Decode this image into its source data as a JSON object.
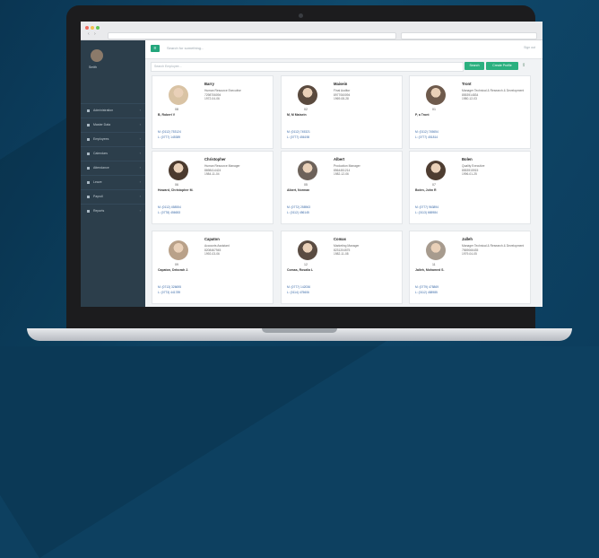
{
  "app": {
    "quick_search_placeholder": "Search for something...",
    "signout_label": "Sign out",
    "user_name": "Smith"
  },
  "sidebar": {
    "items": [
      {
        "label": "Administration"
      },
      {
        "label": "Master Data"
      },
      {
        "label": "Employees"
      },
      {
        "label": "Calendars"
      },
      {
        "label": "Attendance"
      },
      {
        "label": "Leave"
      },
      {
        "label": "Payroll"
      },
      {
        "label": "Reports"
      }
    ]
  },
  "search": {
    "placeholder": "Search Employee...",
    "search_button": "Search",
    "create_button": "Create Profile"
  },
  "employees": [
    {
      "first": "Barry",
      "title": "Human Resource Executive",
      "id": "7298706094",
      "dob": "1972-04-06",
      "code": "08",
      "name": "B, Robert V",
      "m": "M: (0112) 753124",
      "l": "L: (0777) 145389"
    },
    {
      "first": "Maisein",
      "title": "Final Auditor",
      "id": "8977060094",
      "dob": "1969-08-28",
      "code": "02",
      "name": "M, M Maisein",
      "m": "M: (0112) 745321",
      "l": "L: (0777) 456198"
    },
    {
      "first": "Tront",
      "title": "Manager Technical & Research & Development",
      "id": "8553914834",
      "dob": "1980-12-03",
      "code": "01",
      "name": "P, a Tront",
      "m": "M: (0112) 745654",
      "l": "L: (0777) 451814"
    },
    {
      "first": "Christopher",
      "title": "Human Resource Manager",
      "id": "8698414424",
      "dob": "1984-11-04",
      "code": "06",
      "name": "Howard, Christopher M.",
      "m": "M: (0112) 458554",
      "l": "L: (0778) 456653"
    },
    {
      "first": "Albert",
      "title": "Production Manager",
      "id": "8564451214",
      "dob": "1982-12-06",
      "code": "05",
      "name": "Albert, Norman",
      "m": "M: (0772) 258963",
      "l": "L: (0112) 456145"
    },
    {
      "first": "Bolen",
      "title": "Quality Executive",
      "id": "8553915915",
      "dob": "1996-01-25",
      "code": "07",
      "name": "Bolen, John R",
      "m": "M: (0777) 963894",
      "l": "L: (0113) 665984"
    },
    {
      "first": "Capaton",
      "title": "Accounts Assistant",
      "id": "8208467945",
      "dob": "1992-03-06",
      "code": "09",
      "name": "Capaton, Deborah J.",
      "m": "M: (0713) 326695",
      "l": "L: (0773) 441789"
    },
    {
      "first": "Comas",
      "title": "Marketing Manager",
      "id": "8231204575",
      "dob": "1982-11-08",
      "code": "12",
      "name": "Comas, Rosalia L",
      "m": "M: (0777) 142036",
      "l": "L: (0114) 475606"
    },
    {
      "first": "Jalleh",
      "title": "Manager Technical & Research & Development",
      "id": "7569066435",
      "dob": "1979-04-05",
      "code": "11",
      "name": "Jalleh, Mohamed S.",
      "m": "M: (0779) 475869",
      "l": "L: (0112) 458985"
    }
  ],
  "colors": {
    "accent": "#2bb07f",
    "sidebar": "#2c3e4b",
    "phone_link": "#3a6aa8"
  },
  "icons": [
    "hamburger-icon",
    "export-icon",
    "gear-icon",
    "chevron-right-icon"
  ]
}
